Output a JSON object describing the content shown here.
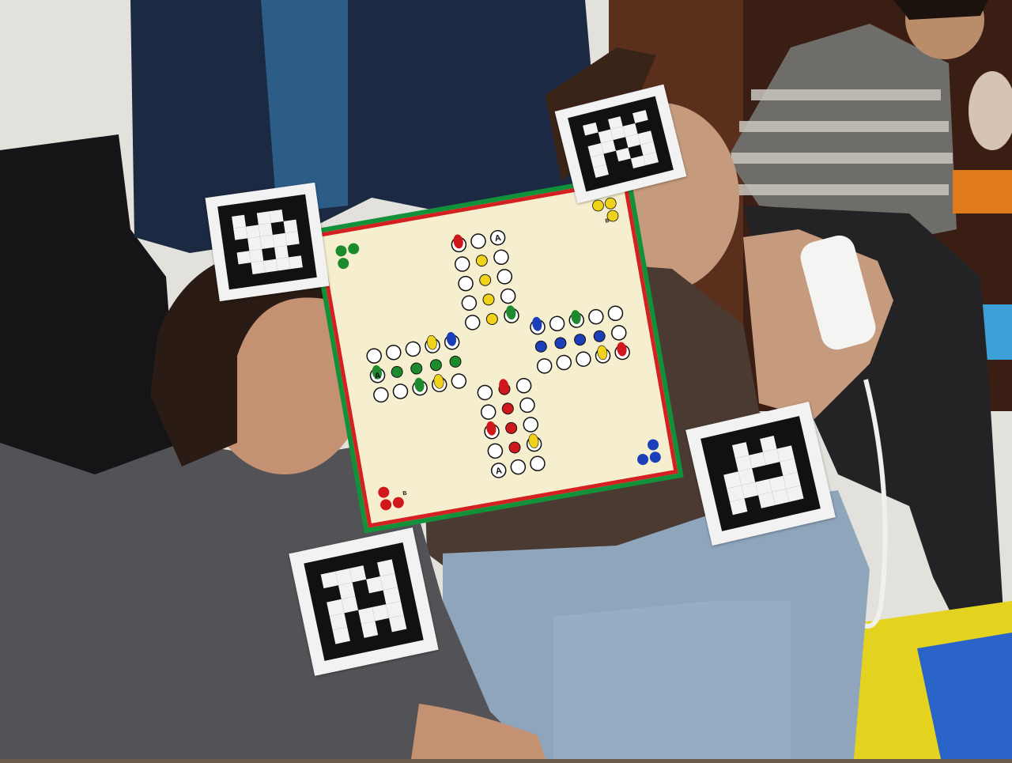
{
  "scene": {
    "description_colors": {
      "wall": "#e8e6e1",
      "couch": "#1c1c1e",
      "jacket": "#1d2a44",
      "wood": "#6b3a22",
      "mat_yellow": "#e6d21f",
      "mat_blue": "#2b64c9"
    }
  },
  "board": {
    "colors": {
      "border_green": "#11913a",
      "rim_red": "#d42020",
      "field": "#f5efcf",
      "green": "#1e8a2e",
      "yellow": "#f1d21a",
      "blue": "#1b3fb8",
      "red": "#d0181c"
    },
    "corner_letters": [
      "A",
      "A",
      "A",
      "B",
      "B"
    ]
  },
  "markers": [
    {
      "name": "marker-top-left"
    },
    {
      "name": "marker-top-right"
    },
    {
      "name": "marker-right"
    },
    {
      "name": "marker-bottom"
    }
  ]
}
